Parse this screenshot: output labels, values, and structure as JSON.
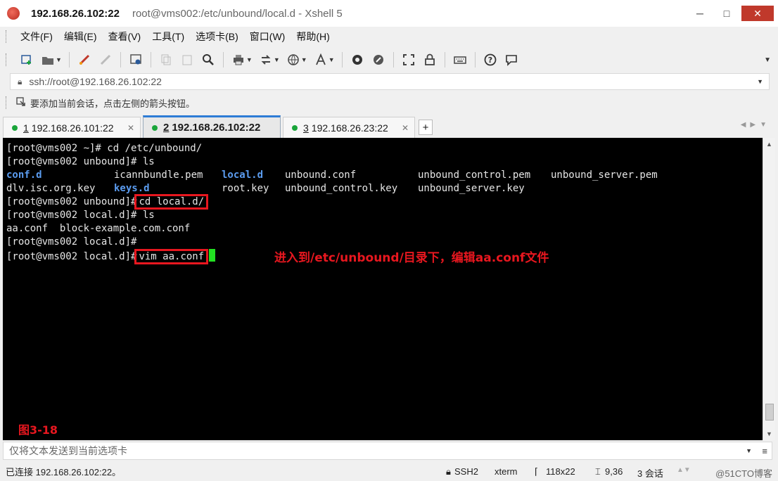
{
  "window": {
    "title_ip": "192.168.26.102:22",
    "title_rest": "root@vms002:/etc/unbound/local.d - Xshell 5",
    "controls": {
      "minimize": "─",
      "maximize": "□",
      "close": "✕"
    }
  },
  "menubar": {
    "items": [
      "文件(F)",
      "编辑(E)",
      "查看(V)",
      "工具(T)",
      "选项卡(B)",
      "窗口(W)",
      "帮助(H)"
    ]
  },
  "toolbar": {
    "icons": [
      "new-session-icon",
      "open-folder-icon",
      "connect-icon",
      "disconnect-icon",
      "properties-icon",
      "copy-icon",
      "paste-icon",
      "find-icon",
      "print-icon",
      "transfer-icon",
      "globe-icon",
      "font-icon",
      "xftp-icon",
      "script-icon",
      "fullscreen-icon",
      "lock-icon",
      "keyboard-icon",
      "help-icon",
      "chat-icon"
    ]
  },
  "address": {
    "value": "ssh://root@192.168.26.102:22"
  },
  "hint": {
    "text": "要添加当前会话，点击左侧的箭头按钮。"
  },
  "tabs": [
    {
      "num": "1",
      "label": "192.168.26.101:22",
      "active": false
    },
    {
      "num": "2",
      "label": "192.168.26.102:22",
      "active": true
    },
    {
      "num": "3",
      "label": "192.168.26.23:22",
      "active": false
    }
  ],
  "terminal": {
    "line1": "[root@vms002 ~]# cd /etc/unbound/",
    "line2": "[root@vms002 unbound]# ls",
    "ls1": {
      "c1": "conf.d",
      "c2": "icannbundle.pem",
      "c3": "local.d",
      "c4": "unbound.conf",
      "c5": "unbound_control.pem",
      "c6": "unbound_server.pem"
    },
    "ls2": {
      "c1": "dlv.isc.org.key",
      "c2": "keys.d",
      "c3": "root.key",
      "c4": "unbound_control.key",
      "c5": "unbound_server.key"
    },
    "line5_prompt": "[root@vms002 unbound]#",
    "line5_cmd": "cd local.d/",
    "line6": "[root@vms002 local.d]# ls",
    "line7": "aa.conf  block-example.com.conf",
    "line8": "[root@vms002 local.d]#",
    "line9_prompt": "[root@vms002 local.d]#",
    "line9_cmd": "vim aa.conf",
    "annotation": "进入到/etc/unbound/目录下，编辑aa.conf文件",
    "figure_label": "图3-18"
  },
  "sendbar": {
    "placeholder": "仅将文本发送到当前选项卡"
  },
  "status": {
    "connection": "已连接 192.168.26.102:22。",
    "protocol": "SSH2",
    "terminal_type": "xterm",
    "size": "118x22",
    "cursor_pos": "9,36",
    "sessions": "3 会话",
    "watermark": "@51CTO博客"
  }
}
